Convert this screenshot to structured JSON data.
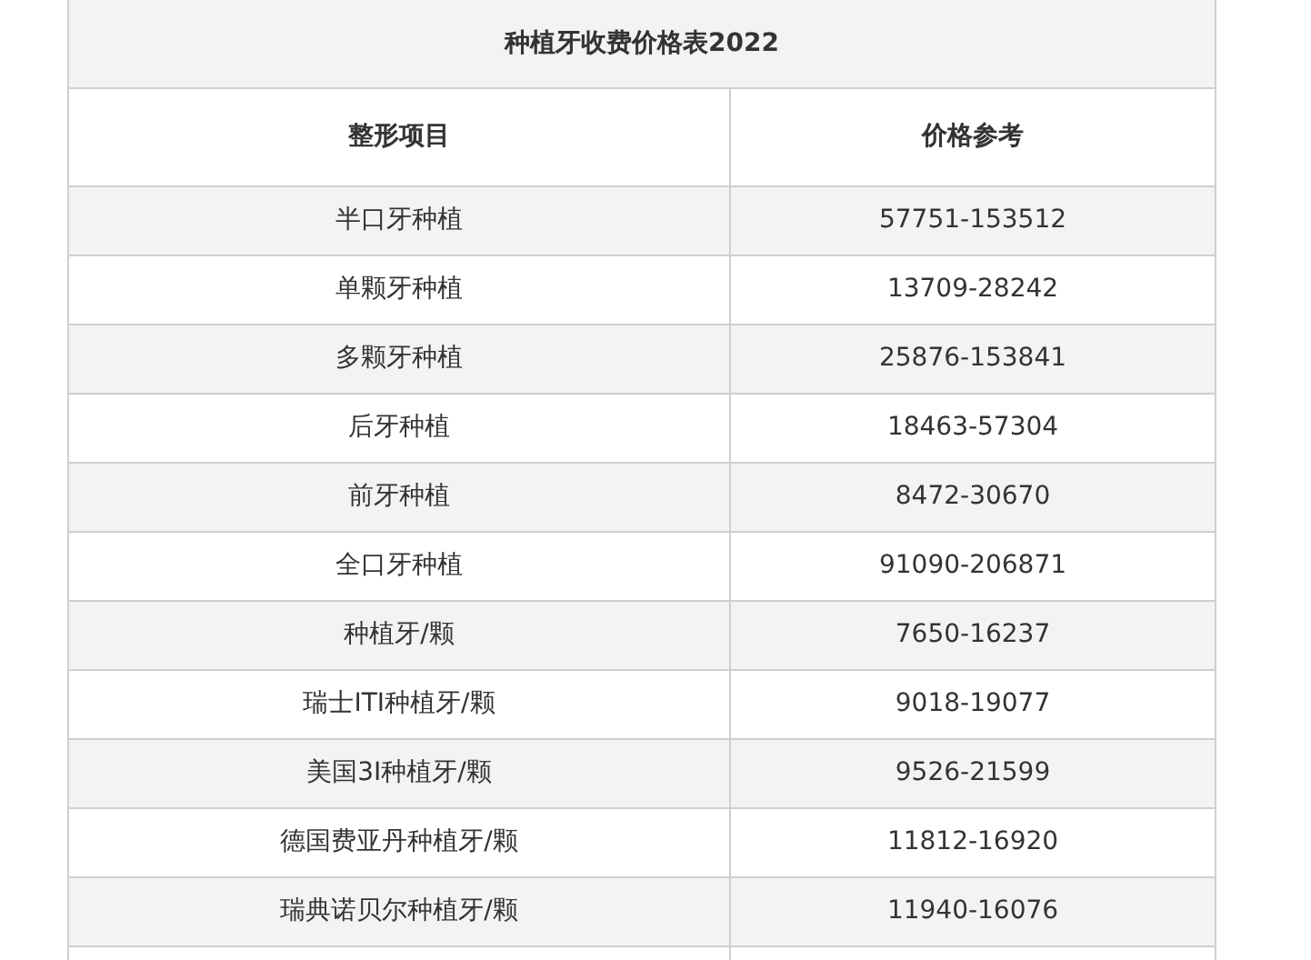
{
  "table": {
    "title": "种植牙收费价格表2022",
    "columns": [
      "整形项目",
      "价格参考"
    ],
    "rows": [
      {
        "item": "半口牙种植",
        "price": "57751-153512"
      },
      {
        "item": "单颗牙种植",
        "price": "13709-28242"
      },
      {
        "item": "多颗牙种植",
        "price": "25876-153841"
      },
      {
        "item": "后牙种植",
        "price": "18463-57304"
      },
      {
        "item": "前牙种植",
        "price": "8472-30670"
      },
      {
        "item": "全口牙种植",
        "price": "91090-206871"
      },
      {
        "item": "种植牙/颗",
        "price": "7650-16237"
      },
      {
        "item": "瑞士ITI种植牙/颗",
        "price": "9018-19077"
      },
      {
        "item": "美国3I种植牙/颗",
        "price": "9526-21599"
      },
      {
        "item": "德国费亚丹种植牙/颗",
        "price": "11812-16920"
      },
      {
        "item": "瑞典诺贝尔种植牙/颗",
        "price": "11940-16076"
      }
    ]
  }
}
